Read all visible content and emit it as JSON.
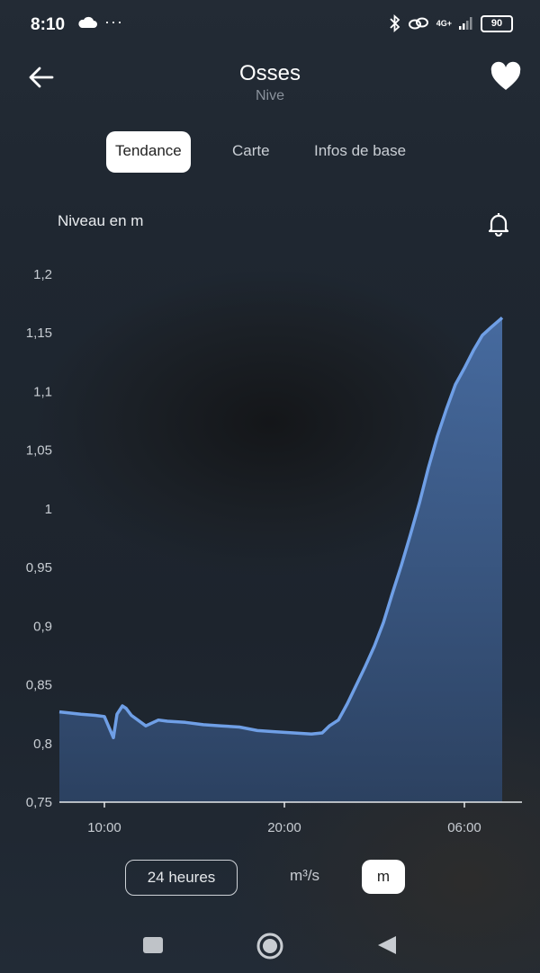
{
  "status_bar": {
    "time": "8:10",
    "icons": [
      "cloud-icon",
      "more-dots-icon",
      "bluetooth-icon",
      "link-icon",
      "4g-signal-icon",
      "battery-icon"
    ],
    "network": "4G+",
    "dots": "···",
    "battery": "90"
  },
  "header": {
    "title": "Osses",
    "subtitle": "Nive",
    "back_icon": "arrow-left-icon",
    "favorite_icon": "heart-icon"
  },
  "tabs": [
    {
      "label": "Tendance",
      "active": true
    },
    {
      "label": "Carte",
      "active": false
    },
    {
      "label": "Infos de base",
      "active": false
    }
  ],
  "chart_section": {
    "label": "Niveau en m",
    "alert_icon": "bell-icon"
  },
  "chart_data": {
    "type": "area",
    "title": "Niveau en m",
    "xlabel": "",
    "ylabel": "",
    "x_ticks": [
      "10:00",
      "20:00",
      "06:00"
    ],
    "y_ticks": [
      "0,75",
      "0,8",
      "0,85",
      "0,9",
      "0,95",
      "1",
      "1,05",
      "1,1",
      "1,15",
      "1,2"
    ],
    "ylim": [
      0.75,
      1.2
    ],
    "x_unit": "hours since 07:30",
    "xlim": [
      0,
      24.6
    ],
    "series": [
      {
        "name": "",
        "color": "#6f9fe6",
        "x": [
          0,
          1.2,
          2,
          2.5,
          3,
          3.2,
          3.5,
          3.7,
          4,
          4.8,
          5.5,
          6,
          7,
          8,
          9,
          10,
          11,
          12,
          13,
          14,
          14.6,
          15,
          15.5,
          16,
          16.5,
          17,
          17.5,
          18,
          18.5,
          19,
          19.5,
          20,
          20.5,
          21,
          21.5,
          22,
          22.5,
          23,
          23.5,
          24,
          24.6
        ],
        "values": [
          0.827,
          0.825,
          0.824,
          0.823,
          0.805,
          0.825,
          0.832,
          0.83,
          0.824,
          0.815,
          0.82,
          0.819,
          0.818,
          0.816,
          0.815,
          0.814,
          0.811,
          0.81,
          0.809,
          0.808,
          0.809,
          0.815,
          0.82,
          0.834,
          0.85,
          0.866,
          0.883,
          0.903,
          0.928,
          0.952,
          0.978,
          1.005,
          1.035,
          1.062,
          1.085,
          1.106,
          1.12,
          1.135,
          1.148,
          1.155,
          1.163
        ]
      }
    ],
    "grid": false
  },
  "controls": {
    "range_label": "24 heures",
    "unit_flow": "m³/s",
    "unit_level": "m",
    "selected_unit": "m"
  },
  "nav_bar": {
    "icons": [
      "recent-apps-icon",
      "home-icon",
      "back-triangle-icon"
    ]
  }
}
